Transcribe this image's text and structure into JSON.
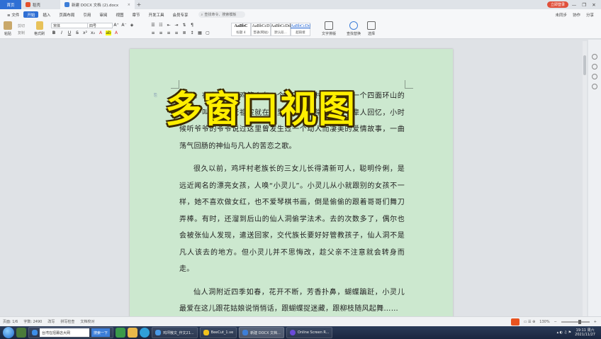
{
  "tabs": {
    "home": "首页",
    "straw": "稻壳",
    "doc": "新建 DOCX 文档 (2).docx",
    "close": "×",
    "add": "+"
  },
  "window": {
    "login": "立即登录",
    "minimize": "—",
    "restore": "❐",
    "close": "✕"
  },
  "menu": {
    "file": "≡ 文件",
    "items": [
      "开始",
      "插入",
      "页面布局",
      "引用",
      "审阅",
      "视图",
      "章节",
      "开发工具",
      "会员专享"
    ],
    "search_placeholder": "查找命令、搜索模板",
    "right": [
      "未同步",
      "协作",
      "分享"
    ]
  },
  "ribbon": {
    "paste": "粘贴",
    "cut": "剪切",
    "copy": "复制",
    "format_painter": "格式刷",
    "font_name": "宋体",
    "font_size": "四号",
    "bold": "B",
    "italic": "I",
    "underline": "U",
    "styles": [
      {
        "sample": "AaBbC",
        "name": "标题 4"
      },
      {
        "sample": "AaBbCcD",
        "name": "普通(网站)"
      },
      {
        "sample": "AaBbCcDd",
        "name": "默认段..."
      },
      {
        "sample": "AaBbCcDd",
        "name": "超链接"
      }
    ],
    "text_layout": "文字排版",
    "find_replace": "查找替换",
    "select": "选择"
  },
  "document": {
    "overlay_title": "多窗口视图",
    "paragraphs": [
      "相传，在宁国西县鸡笼乡有一个寨叫鸡笼村，这里有一个四面环山的小村子叫鸡笼，老祖宗就在村里生活，经常听起老一辈人回忆，小时候听爷爷的爷爷说过这里曾发生过一个动人而凄美的爱情故事，一曲荡气回肠的神仙与凡人的苦恋之歌。",
      "很久以前，鸡坪村老族长的三女儿长得清新可人，聪明伶俐，是远近闻名的漂亮女孩，人唤“小灵儿”。小灵儿从小就跟别的女孩不一样，她不喜欢做女红，也不爱琴棋书画，倒是偷偷的跟着哥哥们舞刀弄棒。有时，还溜到后山的仙人洞偷学法术。去的次数多了，偶尔也会被张仙人发现，遣送回家，交代族长要好好管教孩子，仙人洞不是凡人该去的地方。但小灵儿并不思悔改，趁父亲不注意就会转身而走。",
      "仙人洞附近四季如春，花开不断，芳香扑鼻，蝴蝶蹁跹，小灵儿最爱在这儿跟花姑娘说悄悄话，跟蝴蝶捉迷藏，跟柳枝随风起舞……"
    ]
  },
  "status": {
    "page": "页面: 1/6",
    "words": "字数: 2490",
    "revise": "改写",
    "spell": "拼写检查",
    "proof": "文档校对",
    "zoom": "130%"
  },
  "taskbar": {
    "ie_title": "台湾在招募店大网",
    "search_btn": "搜索一下",
    "items": [
      "鸡坪散文_作文21...",
      "BeeCut_1.ve",
      "新建 DOCX 文档...",
      "Online Screen R..."
    ],
    "time": "19:11 周六",
    "date": "2021/11/27"
  }
}
